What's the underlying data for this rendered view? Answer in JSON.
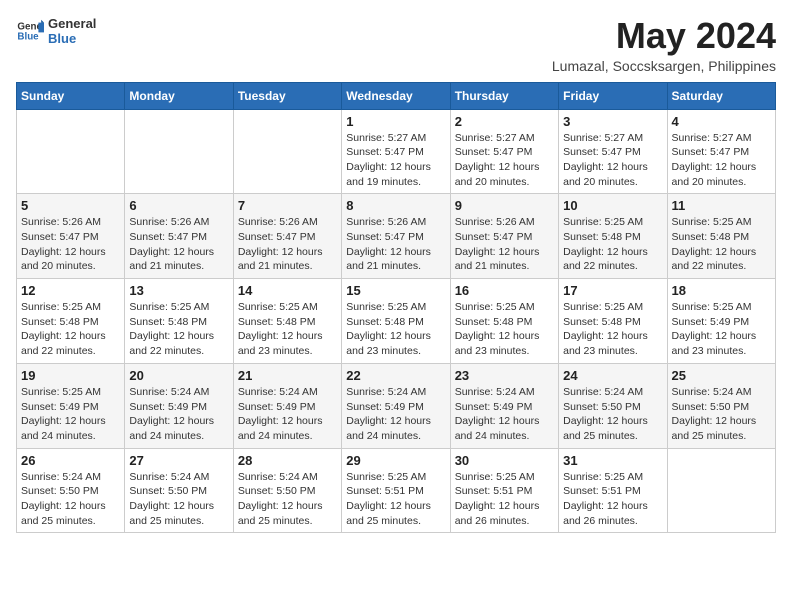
{
  "header": {
    "logo_general": "General",
    "logo_blue": "Blue",
    "month": "May 2024",
    "location": "Lumazal, Soccsksargen, Philippines"
  },
  "weekdays": [
    "Sunday",
    "Monday",
    "Tuesday",
    "Wednesday",
    "Thursday",
    "Friday",
    "Saturday"
  ],
  "weeks": [
    [
      {
        "day": "",
        "sunrise": "",
        "sunset": "",
        "daylight": ""
      },
      {
        "day": "",
        "sunrise": "",
        "sunset": "",
        "daylight": ""
      },
      {
        "day": "",
        "sunrise": "",
        "sunset": "",
        "daylight": ""
      },
      {
        "day": "1",
        "sunrise": "Sunrise: 5:27 AM",
        "sunset": "Sunset: 5:47 PM",
        "daylight": "Daylight: 12 hours and 19 minutes."
      },
      {
        "day": "2",
        "sunrise": "Sunrise: 5:27 AM",
        "sunset": "Sunset: 5:47 PM",
        "daylight": "Daylight: 12 hours and 20 minutes."
      },
      {
        "day": "3",
        "sunrise": "Sunrise: 5:27 AM",
        "sunset": "Sunset: 5:47 PM",
        "daylight": "Daylight: 12 hours and 20 minutes."
      },
      {
        "day": "4",
        "sunrise": "Sunrise: 5:27 AM",
        "sunset": "Sunset: 5:47 PM",
        "daylight": "Daylight: 12 hours and 20 minutes."
      }
    ],
    [
      {
        "day": "5",
        "sunrise": "Sunrise: 5:26 AM",
        "sunset": "Sunset: 5:47 PM",
        "daylight": "Daylight: 12 hours and 20 minutes."
      },
      {
        "day": "6",
        "sunrise": "Sunrise: 5:26 AM",
        "sunset": "Sunset: 5:47 PM",
        "daylight": "Daylight: 12 hours and 21 minutes."
      },
      {
        "day": "7",
        "sunrise": "Sunrise: 5:26 AM",
        "sunset": "Sunset: 5:47 PM",
        "daylight": "Daylight: 12 hours and 21 minutes."
      },
      {
        "day": "8",
        "sunrise": "Sunrise: 5:26 AM",
        "sunset": "Sunset: 5:47 PM",
        "daylight": "Daylight: 12 hours and 21 minutes."
      },
      {
        "day": "9",
        "sunrise": "Sunrise: 5:26 AM",
        "sunset": "Sunset: 5:47 PM",
        "daylight": "Daylight: 12 hours and 21 minutes."
      },
      {
        "day": "10",
        "sunrise": "Sunrise: 5:25 AM",
        "sunset": "Sunset: 5:48 PM",
        "daylight": "Daylight: 12 hours and 22 minutes."
      },
      {
        "day": "11",
        "sunrise": "Sunrise: 5:25 AM",
        "sunset": "Sunset: 5:48 PM",
        "daylight": "Daylight: 12 hours and 22 minutes."
      }
    ],
    [
      {
        "day": "12",
        "sunrise": "Sunrise: 5:25 AM",
        "sunset": "Sunset: 5:48 PM",
        "daylight": "Daylight: 12 hours and 22 minutes."
      },
      {
        "day": "13",
        "sunrise": "Sunrise: 5:25 AM",
        "sunset": "Sunset: 5:48 PM",
        "daylight": "Daylight: 12 hours and 22 minutes."
      },
      {
        "day": "14",
        "sunrise": "Sunrise: 5:25 AM",
        "sunset": "Sunset: 5:48 PM",
        "daylight": "Daylight: 12 hours and 23 minutes."
      },
      {
        "day": "15",
        "sunrise": "Sunrise: 5:25 AM",
        "sunset": "Sunset: 5:48 PM",
        "daylight": "Daylight: 12 hours and 23 minutes."
      },
      {
        "day": "16",
        "sunrise": "Sunrise: 5:25 AM",
        "sunset": "Sunset: 5:48 PM",
        "daylight": "Daylight: 12 hours and 23 minutes."
      },
      {
        "day": "17",
        "sunrise": "Sunrise: 5:25 AM",
        "sunset": "Sunset: 5:48 PM",
        "daylight": "Daylight: 12 hours and 23 minutes."
      },
      {
        "day": "18",
        "sunrise": "Sunrise: 5:25 AM",
        "sunset": "Sunset: 5:49 PM",
        "daylight": "Daylight: 12 hours and 23 minutes."
      }
    ],
    [
      {
        "day": "19",
        "sunrise": "Sunrise: 5:25 AM",
        "sunset": "Sunset: 5:49 PM",
        "daylight": "Daylight: 12 hours and 24 minutes."
      },
      {
        "day": "20",
        "sunrise": "Sunrise: 5:24 AM",
        "sunset": "Sunset: 5:49 PM",
        "daylight": "Daylight: 12 hours and 24 minutes."
      },
      {
        "day": "21",
        "sunrise": "Sunrise: 5:24 AM",
        "sunset": "Sunset: 5:49 PM",
        "daylight": "Daylight: 12 hours and 24 minutes."
      },
      {
        "day": "22",
        "sunrise": "Sunrise: 5:24 AM",
        "sunset": "Sunset: 5:49 PM",
        "daylight": "Daylight: 12 hours and 24 minutes."
      },
      {
        "day": "23",
        "sunrise": "Sunrise: 5:24 AM",
        "sunset": "Sunset: 5:49 PM",
        "daylight": "Daylight: 12 hours and 24 minutes."
      },
      {
        "day": "24",
        "sunrise": "Sunrise: 5:24 AM",
        "sunset": "Sunset: 5:50 PM",
        "daylight": "Daylight: 12 hours and 25 minutes."
      },
      {
        "day": "25",
        "sunrise": "Sunrise: 5:24 AM",
        "sunset": "Sunset: 5:50 PM",
        "daylight": "Daylight: 12 hours and 25 minutes."
      }
    ],
    [
      {
        "day": "26",
        "sunrise": "Sunrise: 5:24 AM",
        "sunset": "Sunset: 5:50 PM",
        "daylight": "Daylight: 12 hours and 25 minutes."
      },
      {
        "day": "27",
        "sunrise": "Sunrise: 5:24 AM",
        "sunset": "Sunset: 5:50 PM",
        "daylight": "Daylight: 12 hours and 25 minutes."
      },
      {
        "day": "28",
        "sunrise": "Sunrise: 5:24 AM",
        "sunset": "Sunset: 5:50 PM",
        "daylight": "Daylight: 12 hours and 25 minutes."
      },
      {
        "day": "29",
        "sunrise": "Sunrise: 5:25 AM",
        "sunset": "Sunset: 5:51 PM",
        "daylight": "Daylight: 12 hours and 25 minutes."
      },
      {
        "day": "30",
        "sunrise": "Sunrise: 5:25 AM",
        "sunset": "Sunset: 5:51 PM",
        "daylight": "Daylight: 12 hours and 26 minutes."
      },
      {
        "day": "31",
        "sunrise": "Sunrise: 5:25 AM",
        "sunset": "Sunset: 5:51 PM",
        "daylight": "Daylight: 12 hours and 26 minutes."
      },
      {
        "day": "",
        "sunrise": "",
        "sunset": "",
        "daylight": ""
      }
    ]
  ]
}
